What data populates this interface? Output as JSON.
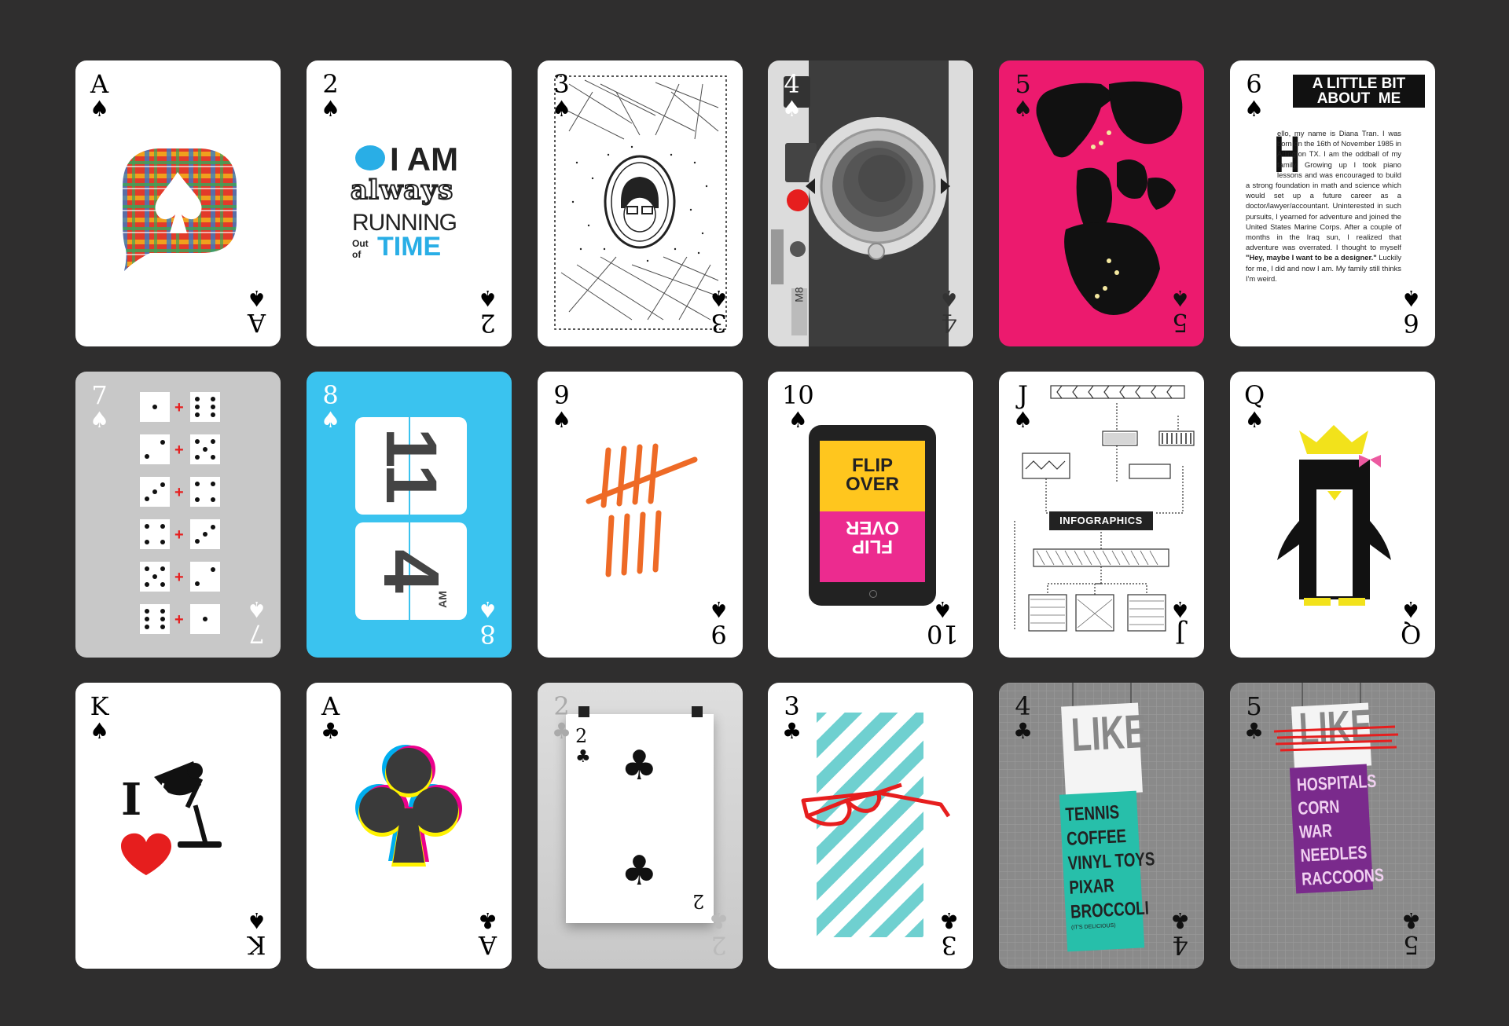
{
  "background": "#2f2e2e",
  "suit_symbols": {
    "spade": "♠",
    "club": "♣",
    "heart": "♥"
  },
  "cards": [
    {
      "rank": "A",
      "suit": "♠",
      "theme": "plaid-speech-bubble"
    },
    {
      "rank": "2",
      "suit": "♠",
      "theme": "typography",
      "lines": [
        "I AM",
        "always",
        "RUNNING",
        "Out",
        "of",
        "TIME"
      ]
    },
    {
      "rank": "3",
      "suit": "♠",
      "theme": "sketch-portrait"
    },
    {
      "rank": "4",
      "suit": "♠",
      "theme": "camera",
      "camera_model": "M8"
    },
    {
      "rank": "5",
      "suit": "♠",
      "theme": "world-map",
      "color": "#ec1a6e"
    },
    {
      "rank": "6",
      "suit": "♠",
      "theme": "bio",
      "heading": [
        "A LITTLE BIT",
        "ABOUT  ME"
      ],
      "dropcap": "H",
      "paragraph": "ello, my name is Diana Tran. I was born on the 16th of November 1985 in Arlington TX.  I am the oddball of my family. Growing up I took piano lessons and was encouraged to build a strong foundation in math and science which would set up a future career as a doctor/lawyer/accountant. Uninterested in such pursuits, I yearned for adventure and joined the United States Marine Corps. After a couple of months in the Iraq sun, I realized that adventure was overrated. I thought to myself ",
      "bold_quote": "\"Hey, maybe I want to be a designer.\"",
      "paragraph_end": " Luckily for me, I did and now I am.  My family still thinks I'm weird."
    },
    {
      "rank": "7",
      "suit": "♠",
      "theme": "dice",
      "color": "#c8c8c8"
    },
    {
      "rank": "8",
      "suit": "♠",
      "theme": "flip-clock",
      "color": "#3ac3ef",
      "top": "11",
      "bottom": "4",
      "ampm": "AM"
    },
    {
      "rank": "9",
      "suit": "♠",
      "theme": "tally-marks",
      "color": "#ee6a26"
    },
    {
      "rank": "10",
      "suit": "♠",
      "theme": "tablet",
      "top_text": [
        "FLIP",
        "OVER"
      ],
      "bottom_text": [
        "FLIP",
        "OVER"
      ]
    },
    {
      "rank": "J",
      "suit": "♠",
      "theme": "infographic",
      "label": "INFOGRAPHICS"
    },
    {
      "rank": "Q",
      "suit": "♠",
      "theme": "penguin"
    },
    {
      "rank": "K",
      "suit": "♠",
      "theme": "i-heart-lamp",
      "letter": "I"
    },
    {
      "rank": "A",
      "suit": "♣",
      "theme": "cmyk-club"
    },
    {
      "rank": "2",
      "suit": "♣",
      "theme": "hanging-card",
      "inner_rank": "2"
    },
    {
      "rank": "3",
      "suit": "♣",
      "theme": "sunglasses-stripes",
      "color": "#6fd0d0"
    },
    {
      "rank": "4",
      "suit": "♣",
      "theme": "like-banner",
      "banner": "LIKE",
      "items": [
        "TENNIS",
        "COFFEE",
        "VINYL TOYS",
        "PIXAR",
        "BROCCOLI"
      ],
      "note": "(IT'S DELICIOUS)",
      "color": "#27bfaa"
    },
    {
      "rank": "5",
      "suit": "♣",
      "theme": "dislike-banner",
      "banner": "LIKE",
      "items": [
        "HOSPITALS",
        "CORN",
        "WAR",
        "NEEDLES",
        "RACCOONS"
      ],
      "color": "#7a2a8c"
    }
  ]
}
